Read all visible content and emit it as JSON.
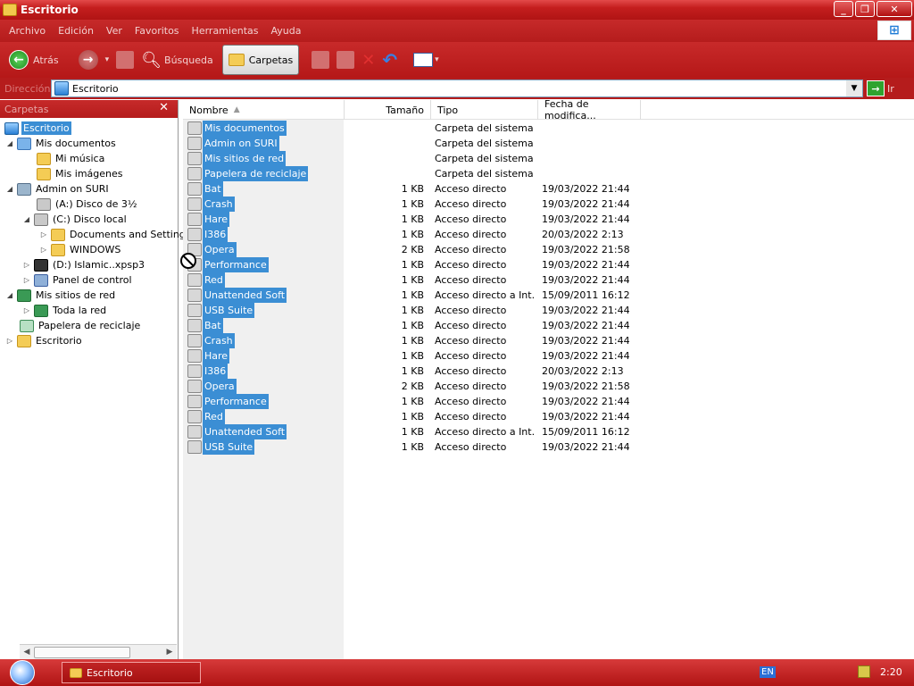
{
  "window": {
    "title": "Escritorio"
  },
  "menu": [
    "Archivo",
    "Edición",
    "Ver",
    "Favoritos",
    "Herramientas",
    "Ayuda"
  ],
  "toolbar": {
    "back": "Atrás",
    "search": "Búsqueda",
    "folders": "Carpetas"
  },
  "address": {
    "label": "Dirección",
    "value": "Escritorio",
    "go": "Ir"
  },
  "folders_pane": {
    "header": "Carpetas",
    "tree": [
      {
        "label": "Escritorio",
        "icon": "desktop-icon",
        "selected": true
      },
      {
        "label": "Mis documentos",
        "icon": "documents-icon"
      },
      {
        "label": "Mi música",
        "icon": "music-folder-icon"
      },
      {
        "label": "Mis imágenes",
        "icon": "pictures-folder-icon"
      },
      {
        "label": "Admin on SURI",
        "icon": "computer-icon"
      },
      {
        "label": "(A:) Disco de 3½",
        "icon": "floppy-icon"
      },
      {
        "label": "(C:) Disco local",
        "icon": "drive-icon"
      },
      {
        "label": "Documents and Settings",
        "icon": "folder-icon"
      },
      {
        "label": "WINDOWS",
        "icon": "folder-icon"
      },
      {
        "label": "(D:) Islamic..xpsp3",
        "icon": "cd-icon"
      },
      {
        "label": "Panel de control",
        "icon": "control-panel-icon"
      },
      {
        "label": "Mis sitios de red",
        "icon": "network-icon"
      },
      {
        "label": "Toda la red",
        "icon": "globe-icon"
      },
      {
        "label": "Papelera de reciclaje",
        "icon": "recycle-bin-icon"
      },
      {
        "label": "Escritorio",
        "icon": "desktop-icon"
      }
    ]
  },
  "columns": [
    "Nombre",
    "Tamaño",
    "Tipo",
    "Fecha de modifica..."
  ],
  "files": [
    {
      "name": "Mis documentos",
      "size": "",
      "type": "Carpeta del sistema",
      "date": ""
    },
    {
      "name": "Admin on SURI",
      "size": "",
      "type": "Carpeta del sistema",
      "date": ""
    },
    {
      "name": "Mis sitios de red",
      "size": "",
      "type": "Carpeta del sistema",
      "date": ""
    },
    {
      "name": "Papelera de reciclaje",
      "size": "",
      "type": "Carpeta del sistema",
      "date": ""
    },
    {
      "name": "Bat",
      "size": "1 KB",
      "type": "Acceso directo",
      "date": "19/03/2022 21:44"
    },
    {
      "name": "Crash",
      "size": "1 KB",
      "type": "Acceso directo",
      "date": "19/03/2022 21:44"
    },
    {
      "name": "Hare",
      "size": "1 KB",
      "type": "Acceso directo",
      "date": "19/03/2022 21:44"
    },
    {
      "name": "I386",
      "size": "1 KB",
      "type": "Acceso directo",
      "date": "20/03/2022 2:13"
    },
    {
      "name": "Opera",
      "size": "2 KB",
      "type": "Acceso directo",
      "date": "19/03/2022 21:58"
    },
    {
      "name": "Performance",
      "size": "1 KB",
      "type": "Acceso directo",
      "date": "19/03/2022 21:44"
    },
    {
      "name": "Red",
      "size": "1 KB",
      "type": "Acceso directo",
      "date": "19/03/2022 21:44"
    },
    {
      "name": "Unattended Soft",
      "size": "1 KB",
      "type": "Acceso directo a Int...",
      "date": "15/09/2011 16:12"
    },
    {
      "name": "USB Suite",
      "size": "1 KB",
      "type": "Acceso directo",
      "date": "19/03/2022 21:44"
    },
    {
      "name": "Bat",
      "size": "1 KB",
      "type": "Acceso directo",
      "date": "19/03/2022 21:44"
    },
    {
      "name": "Crash",
      "size": "1 KB",
      "type": "Acceso directo",
      "date": "19/03/2022 21:44"
    },
    {
      "name": "Hare",
      "size": "1 KB",
      "type": "Acceso directo",
      "date": "19/03/2022 21:44"
    },
    {
      "name": "I386",
      "size": "1 KB",
      "type": "Acceso directo",
      "date": "20/03/2022 2:13"
    },
    {
      "name": "Opera",
      "size": "2 KB",
      "type": "Acceso directo",
      "date": "19/03/2022 21:58"
    },
    {
      "name": "Performance",
      "size": "1 KB",
      "type": "Acceso directo",
      "date": "19/03/2022 21:44"
    },
    {
      "name": "Red",
      "size": "1 KB",
      "type": "Acceso directo",
      "date": "19/03/2022 21:44"
    },
    {
      "name": "Unattended Soft",
      "size": "1 KB",
      "type": "Acceso directo a Int...",
      "date": "15/09/2011 16:12"
    },
    {
      "name": "USB Suite",
      "size": "1 KB",
      "type": "Acceso directo",
      "date": "19/03/2022 21:44"
    }
  ],
  "taskbar": {
    "task": "Escritorio",
    "language": "EN",
    "clock": "2:20"
  },
  "colors": {
    "chrome_red": "#b51c1c",
    "selection_blue": "#3b8ed4"
  }
}
